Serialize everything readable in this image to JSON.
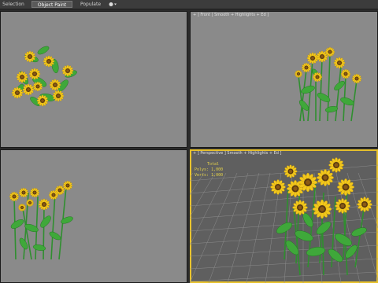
{
  "ribbon": {
    "tabs": [
      "Selection",
      "Object Paint",
      "Populate"
    ],
    "active_tab": "Object Paint",
    "options_icon": "dropdown-circle-icon"
  },
  "viewports": {
    "top_left": {
      "label": ""
    },
    "top_right": {
      "label": "+ ] Front ] Smooth + Highlights + Ed ]"
    },
    "bottom_left": {
      "label": ""
    },
    "bottom_right": {
      "label": "+ ] Perspective ] Smooth + Highlights + Ed ]",
      "stats": {
        "title": "Total",
        "polys": "Polys: 1,000",
        "verts": "Verts: 1,000"
      }
    }
  },
  "colors": {
    "viewport_bg": "#8a8a8a",
    "active_viewport_bg": "#5f5f5f",
    "active_border": "#e8c22c",
    "petal": "#f3c81c",
    "leaf": "#3fa83a",
    "stem": "#2f8f2f"
  }
}
